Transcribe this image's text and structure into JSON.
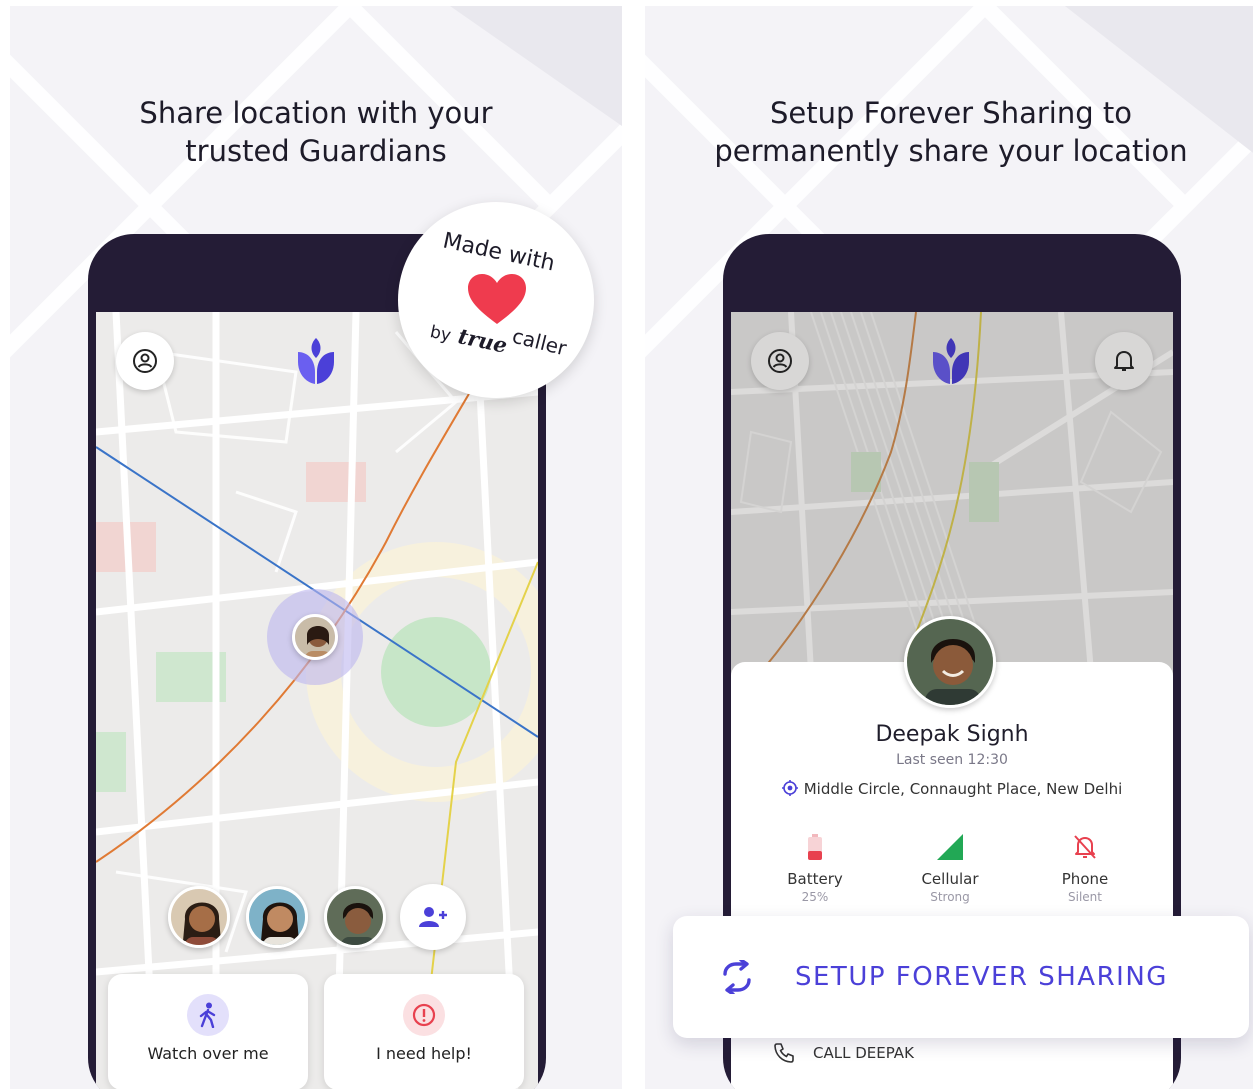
{
  "left_panel": {
    "headline_line1": "Share location with your",
    "headline_line2": "trusted Guardians",
    "badge": {
      "made_with": "Made with",
      "by": "by",
      "brand_a": "true",
      "brand_b": "caller"
    },
    "actions": {
      "watch_label": "Watch over me",
      "help_label": "I need help!"
    },
    "icons": [
      "profile-icon",
      "guardians-logo-icon",
      "heart-icon",
      "walk-icon",
      "alert-icon",
      "add-person-icon"
    ]
  },
  "right_panel": {
    "headline_line1": "Setup Forever Sharing to",
    "headline_line2": "permanently share your location",
    "contact": {
      "name": "Deepak Signh",
      "last_seen": "Last seen 12:30",
      "address": "Middle Circle, Connaught Place, New Delhi"
    },
    "stats": [
      {
        "label": "Battery",
        "value": "25%"
      },
      {
        "label": "Cellular",
        "value": "Strong"
      },
      {
        "label": "Phone",
        "value": "Silent"
      }
    ],
    "cta_label": "SETUP FOREVER SHARING",
    "call_label": "CALL DEEPAK",
    "icons": [
      "profile-icon",
      "guardians-logo-icon",
      "bell-icon",
      "location-icon",
      "battery-icon",
      "signal-icon",
      "bell-off-icon",
      "sync-icon",
      "phone-icon"
    ]
  },
  "colors": {
    "accent": "#4b40d8",
    "phone_frame": "#241c36",
    "heart": "#ef3b4e",
    "alert": "#e8414f",
    "green": "#22a855"
  }
}
